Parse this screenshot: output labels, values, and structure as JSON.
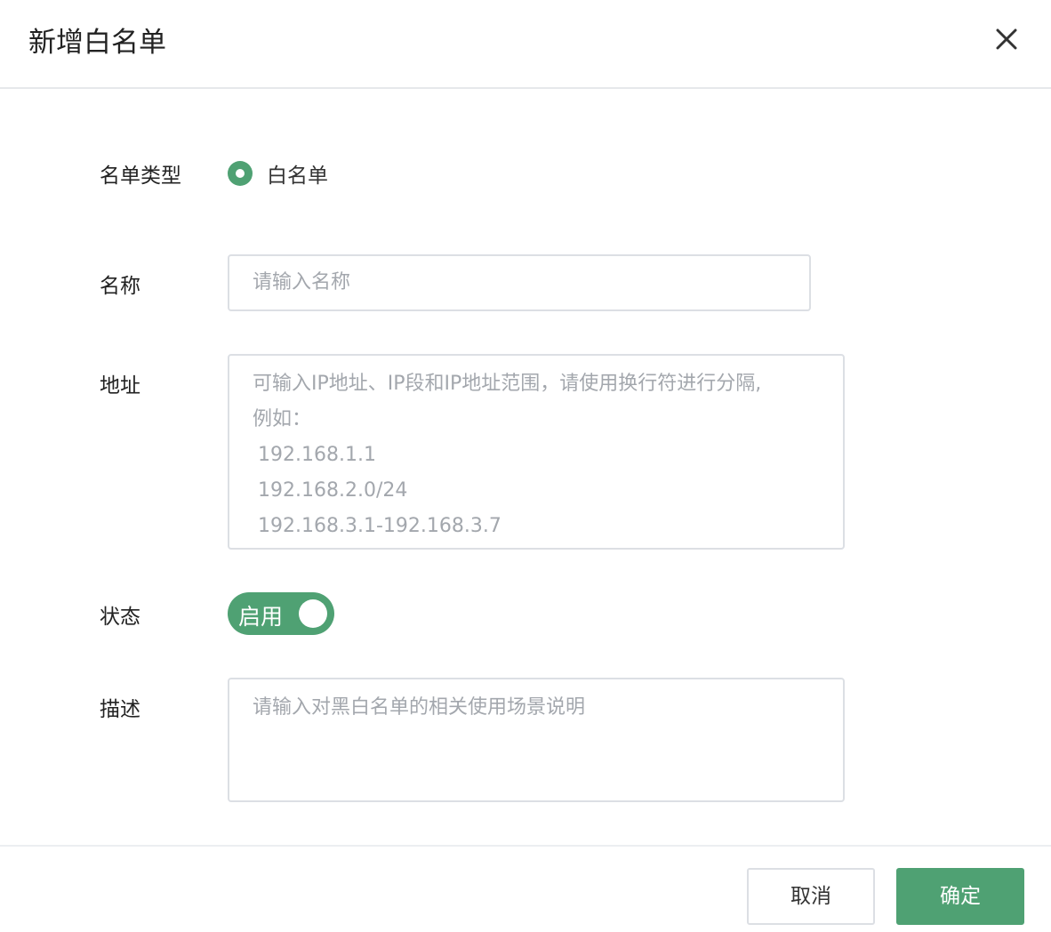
{
  "dialog": {
    "title": "新增白名单"
  },
  "form": {
    "list_type": {
      "label": "名单类型",
      "option_label": "白名单",
      "selected": true
    },
    "name": {
      "label": "名称",
      "value": "",
      "placeholder": "请输入名称"
    },
    "address": {
      "label": "地址",
      "value": "",
      "placeholder_lines": [
        "可输入IP地址、IP段和IP地址范围，请使用换行符进行分隔,",
        "例如：",
        "192.168.1.1",
        "192.168.2.0/24",
        "192.168.3.1-192.168.3.7"
      ]
    },
    "status": {
      "label": "状态",
      "toggle_text": "启用",
      "enabled": true
    },
    "description": {
      "label": "描述",
      "value": "",
      "placeholder": "请输入对黑白名单的相关使用场景说明"
    }
  },
  "footer": {
    "cancel_label": "取消",
    "confirm_label": "确定"
  },
  "colors": {
    "primary": "#4fa173",
    "border": "#dcdfe4"
  },
  "icons": {
    "close": "close-icon"
  }
}
